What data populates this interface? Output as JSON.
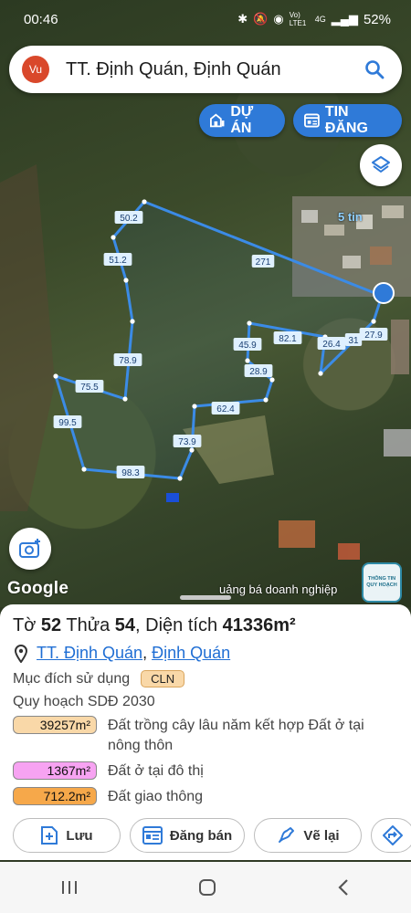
{
  "status": {
    "time": "00:46",
    "network": "Vo) LTE1",
    "signal": "4G",
    "battery": "52%"
  },
  "search": {
    "avatar": "Vu",
    "text": "TT. Định Quán, Định Quán"
  },
  "pills": {
    "duan": "DỰ ÁN",
    "tindang": "TIN ĐĂNG"
  },
  "map": {
    "listing_count": "5 tin",
    "edges": [
      "50.2",
      "271",
      "51.2",
      "78.9",
      "75.5",
      "99.5",
      "98.3",
      "73.9",
      "62.4",
      "28.9",
      "45.9",
      "82.1",
      "26.4",
      "31",
      "27.9"
    ],
    "google": "Google",
    "ad_text": "uảng bá doanh nghiệp",
    "ad_badge": "THÔNG TIN QUY HOẠCH"
  },
  "parcel": {
    "to_label": "Tờ",
    "to_value": "52",
    "thua_label": "Thửa",
    "thua_value": "54",
    "area_label": ", Diện tích",
    "area_value": "41336m²",
    "ward": "TT. Định Quán",
    "separator": ",",
    "district": "Định Quán",
    "purpose_label": "Mục đích sử dụng",
    "purpose_code": "CLN",
    "plan_title": "Quy hoạch SDĐ 2030",
    "plan": [
      {
        "area": "39257m²",
        "desc": "Đất trồng cây lâu năm kết hợp Đất ở tại nông thôn",
        "color": "#f9d8a8"
      },
      {
        "area": "1367m²",
        "desc": "Đất ở tại đô thị",
        "color": "#f7a3f2"
      },
      {
        "area": "712.2m²",
        "desc": "Đất giao thông",
        "color": "#f6a84a"
      }
    ]
  },
  "actions": {
    "save": "Lưu",
    "sell": "Đăng bán",
    "redraw": "Vẽ lại"
  }
}
